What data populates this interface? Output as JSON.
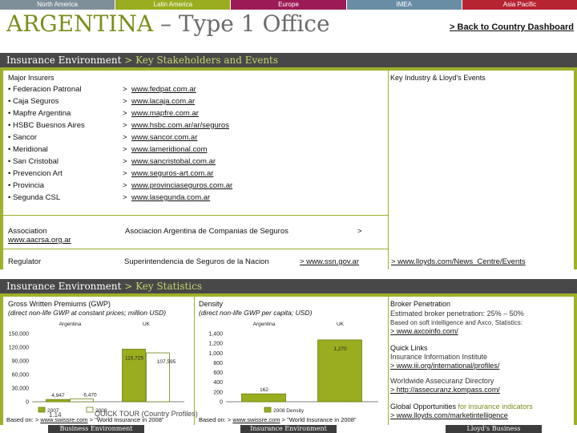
{
  "regions": [
    {
      "label": "North America",
      "color": "#7f8f99"
    },
    {
      "label": "Latin America",
      "color": "#9aad1f"
    },
    {
      "label": "Europe",
      "color": "#9c1a55"
    },
    {
      "label": "IMEA",
      "color": "#6a8da6"
    },
    {
      "label": "Asia Pacific",
      "color": "#b72431"
    }
  ],
  "header": {
    "title_main": "ARGENTINA",
    "title_rest": " – Type 1 Office",
    "back_link": "> Back to Country Dashboard"
  },
  "stakeholders": {
    "bar_title": "Insurance Environment",
    "bar_sub": " > Key Stakeholders and Events",
    "major_insurers_label": "Major Insurers",
    "key_industry_label": "Key Industry & Lloyd's Events",
    "insurers": [
      {
        "name": "• Federacion Patronal",
        "arrow": ">",
        "url": "www.fedpat.com.ar"
      },
      {
        "name": "• Caja Seguros",
        "arrow": ">",
        "url": "www.lacaja.com.ar"
      },
      {
        "name": "• Mapfre Argentina",
        "arrow": ">",
        "url": "www.mapfre.com.ar"
      },
      {
        "name": "• HSBC Buesnos Aires",
        "arrow": ">",
        "url": "www.hsbc.com.ar/ar/seguros"
      },
      {
        "name": "• Sancor",
        "arrow": ">",
        "url": "www.sancor.com.ar"
      },
      {
        "name": "• Meridional",
        "arrow": ">",
        "url": "www.lameridional.com"
      },
      {
        "name": "• San Cristobal",
        "arrow": ">",
        "url": "www.sancristobal.com.ar"
      },
      {
        "name": "• Prevencion Art",
        "arrow": ">",
        "url": "www.seguros-art.com.ar"
      },
      {
        "name": "• Provincia",
        "arrow": ">",
        "url": "www.provinciaseguros.com.ar"
      },
      {
        "name": "• Segunda CSL",
        "arrow": ">",
        "url": "www.lasegunda.com.ar"
      }
    ],
    "association_label": "Association",
    "association_url": "www.aacrsa.org.ar",
    "association_name": "Asociacion Argentina de Companias de Seguros",
    "association_arrow": ">",
    "regulator_label": "Regulator",
    "regulator_name": "Superintendencia de Seguros de la Nacion",
    "regulator_url": "> www.ssn.gov.ar",
    "lloyds_link": "> www.lloyds.com/News_Centre/Events"
  },
  "stats": {
    "bar_title": "Insurance Environment",
    "bar_sub": " > Key Statistics",
    "gwp": {
      "title": "Gross Written Premiums (GWP)",
      "subtitle": "(direct non-life GWP at constant prices; million USD)",
      "source_prefix": "Based on: > ",
      "source_link": "www.swissre.com",
      "source_suffix": " > \"World Insurance in 2008\""
    },
    "density": {
      "title": "Density",
      "subtitle": "(direct non-life GWP per capita; USD)",
      "source_prefix": "Based on: > ",
      "source_link": "www.swissre.com",
      "source_suffix": " > \"World Insurance in 2008\""
    },
    "broker": {
      "title": "Broker Penetration",
      "line1": "Estimated broker penetration: 25% – 50%",
      "line2": "Based on soft intelligence and Axco, Statistics:",
      "link": "> www.axcoinfo.com/",
      "quick_title": "Quick Links",
      "quick_line": "Insurance Information Institute",
      "quick_link": "> www.iii.org/international/profiles/",
      "ww_line": "Worldwide Assecuranz Directory",
      "ww_link": "> http://assecuranz.kompass.com/",
      "opp_line_a": "Global Opportunities ",
      "opp_line_b": "for insurance indicators",
      "opp_link": "> www.lloyds.com/marketintelligence"
    },
    "overlay_text": "QUICK TOUR (Country Profiles)",
    "page_number": "1.14"
  },
  "footer_tabs": [
    "Business Environment",
    "Insurance Environment",
    "Lloyd's Business"
  ],
  "chart_data": [
    {
      "type": "bar",
      "title": "Gross Written Premiums (GWP)",
      "subtitle": "(direct non-life GWP at constant prices; million USD)",
      "categories": [
        "Argentina",
        "UK"
      ],
      "series": [
        {
          "name": "2007",
          "values": [
            4947,
            115725
          ]
        },
        {
          "name": "2008",
          "values": [
            6470,
            107595
          ]
        }
      ],
      "value_labels": [
        [
          "4,947",
          "115,725"
        ],
        [
          "6,470",
          "107,595"
        ]
      ],
      "yticks": [
        "0",
        "30,000",
        "60,000",
        "90,000",
        "120,000",
        "150,000"
      ],
      "ylim": [
        0,
        150000
      ],
      "colors": [
        "#9aad1f",
        "#ffffff"
      ]
    },
    {
      "type": "bar",
      "title": "Density",
      "subtitle": "(direct non-life GWP per capita; USD)",
      "categories": [
        "Argentina",
        "UK"
      ],
      "series": [
        {
          "name": "2008 Density",
          "values": [
            162,
            1270
          ]
        }
      ],
      "value_labels": [
        [
          "162",
          "1,270"
        ]
      ],
      "yticks": [
        "0",
        "200",
        "400",
        "600",
        "800",
        "1,000",
        "1,200",
        "1,400"
      ],
      "ylim": [
        0,
        1400
      ],
      "colors": [
        "#9aad1f"
      ]
    }
  ]
}
